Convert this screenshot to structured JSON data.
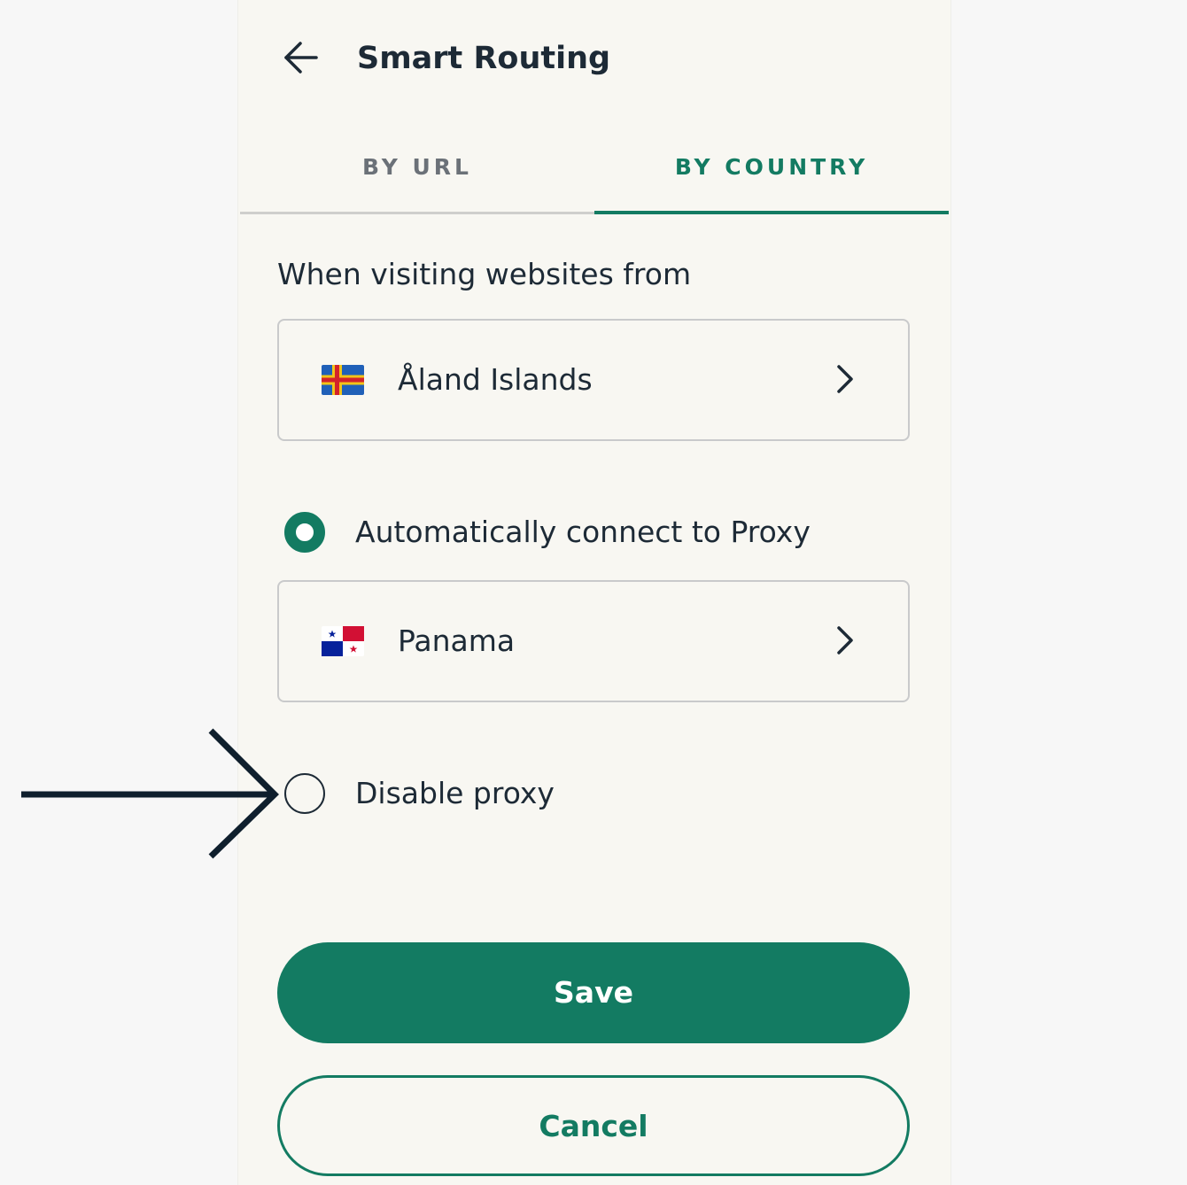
{
  "header": {
    "title": "Smart Routing"
  },
  "tabs": [
    {
      "label": "BY URL",
      "active": false
    },
    {
      "label": "BY COUNTRY",
      "active": true
    }
  ],
  "section_label": "When visiting websites from",
  "from_country": {
    "name": "Åland Islands",
    "flag_icon": "aland-islands-flag-icon"
  },
  "options": [
    {
      "label": "Automatically connect to Proxy",
      "selected": true
    },
    {
      "label": "Disable proxy",
      "selected": false
    }
  ],
  "proxy_country": {
    "name": "Panama",
    "flag_icon": "panama-flag-icon"
  },
  "buttons": {
    "save": "Save",
    "cancel": "Cancel"
  },
  "colors": {
    "accent": "#137b62",
    "text": "#1d2a36",
    "panel_bg": "#f8f7f2"
  }
}
